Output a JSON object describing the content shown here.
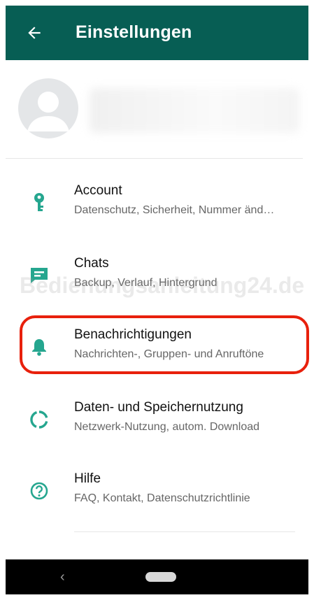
{
  "header": {
    "title": "Einstellungen",
    "back_icon": "arrow-left-icon"
  },
  "profile": {
    "avatar_icon": "person-icon"
  },
  "settings": [
    {
      "title": "Account",
      "subtitle": "Datenschutz, Sicherheit, Nummer änd…",
      "icon": "key-icon"
    },
    {
      "title": "Chats",
      "subtitle": "Backup, Verlauf, Hintergrund",
      "icon": "chat-icon"
    },
    {
      "title": "Benachrichtigungen",
      "subtitle": "Nachrichten-, Gruppen- und Anruftöne",
      "icon": "bell-icon"
    },
    {
      "title": "Daten- und Speichernutzung",
      "subtitle": "Netzwerk-Nutzung, autom. Download",
      "icon": "data-usage-icon"
    },
    {
      "title": "Hilfe",
      "subtitle": "FAQ, Kontakt, Datenschutzrichtlinie",
      "icon": "help-icon"
    }
  ],
  "watermark": "Bedienungsanleitung24.de",
  "navbar": {
    "back_glyph": "‹"
  },
  "colors": {
    "appbar": "#075e54",
    "accent": "#25a68f",
    "highlight": "#e8200c"
  }
}
